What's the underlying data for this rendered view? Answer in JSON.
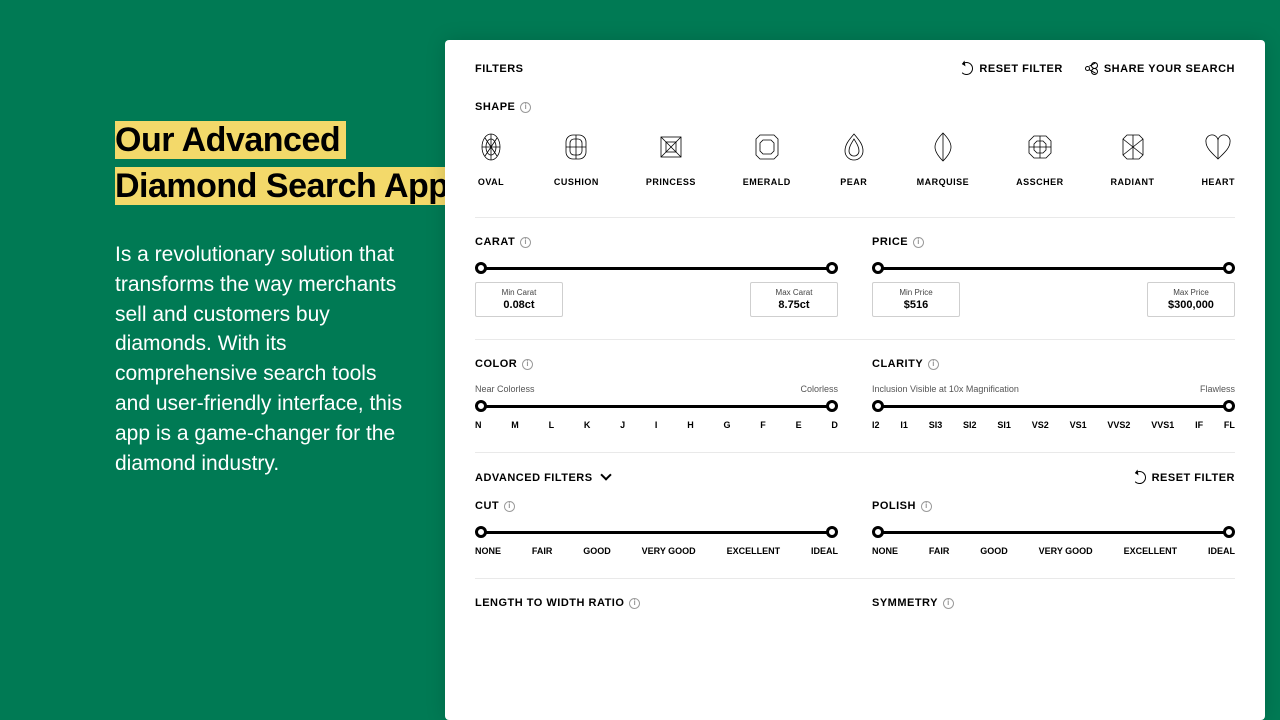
{
  "headline": {
    "line1": "Our Advanced",
    "line2": "Diamond Search App"
  },
  "subtext": "Is a revolutionary solution that transforms the way merchants sell and customers buy diamonds. With its comprehensive search tools and user-friendly interface, this app is a game-changer for the diamond industry.",
  "topbar": {
    "filters": "FILTERS",
    "reset": "RESET FILTER",
    "share": "SHARE YOUR SEARCH"
  },
  "shape": {
    "label": "SHAPE",
    "options": [
      "OVAL",
      "CUSHION",
      "PRINCESS",
      "EMERALD",
      "PEAR",
      "MARQUISE",
      "ASSCHER",
      "RADIANT",
      "HEART"
    ]
  },
  "carat": {
    "label": "CARAT",
    "minLabel": "Min Carat",
    "minValue": "0.08ct",
    "maxLabel": "Max Carat",
    "maxValue": "8.75ct"
  },
  "price": {
    "label": "PRICE",
    "minLabel": "Min Price",
    "minValue": "$516",
    "maxLabel": "Max Price",
    "maxValue": "$300,000"
  },
  "color": {
    "label": "COLOR",
    "hintLeft": "Near Colorless",
    "hintRight": "Colorless",
    "ticks": [
      "N",
      "M",
      "L",
      "K",
      "J",
      "I",
      "H",
      "G",
      "F",
      "E",
      "D"
    ]
  },
  "clarity": {
    "label": "CLARITY",
    "hintLeft": "Inclusion Visible at 10x Magnification",
    "hintRight": "Flawless",
    "ticks": [
      "I2",
      "I1",
      "SI3",
      "SI2",
      "SI1",
      "VS2",
      "VS1",
      "VVS2",
      "VVS1",
      "IF",
      "FL"
    ]
  },
  "advanced": {
    "label": "ADVANCED FILTERS",
    "reset": "RESET FILTER"
  },
  "cut": {
    "label": "CUT",
    "ticks": [
      "NONE",
      "FAIR",
      "GOOD",
      "VERY GOOD",
      "EXCELLENT",
      "IDEAL"
    ]
  },
  "polish": {
    "label": "POLISH",
    "ticks": [
      "NONE",
      "FAIR",
      "GOOD",
      "VERY GOOD",
      "EXCELLENT",
      "IDEAL"
    ]
  },
  "ratio": {
    "label": "LENGTH TO WIDTH RATIO"
  },
  "symmetry": {
    "label": "SYMMETRY"
  }
}
